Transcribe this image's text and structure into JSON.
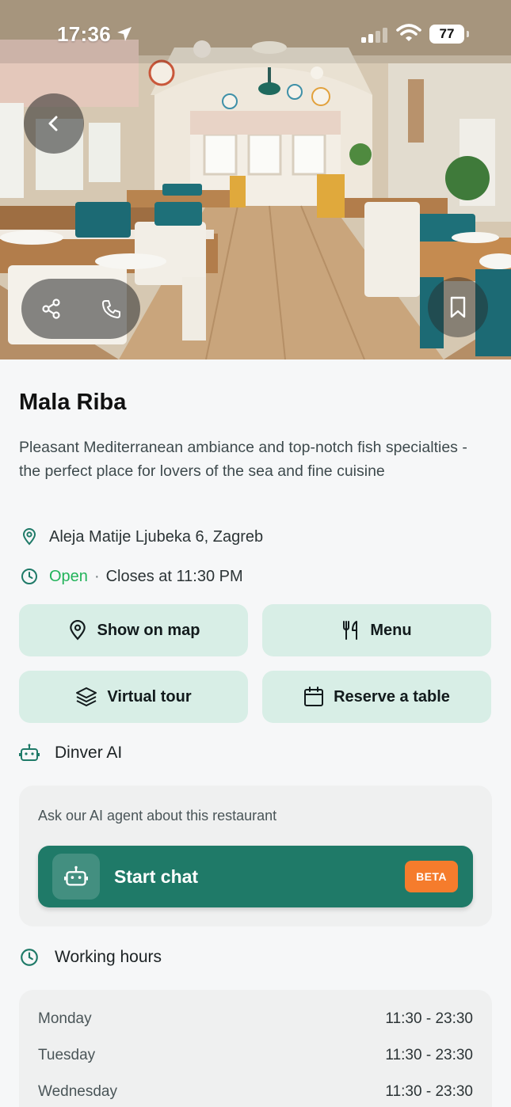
{
  "status_bar": {
    "time": "17:36",
    "battery": "77"
  },
  "hero": {
    "image": "restaurant interior photo with wooden tables and white chairs"
  },
  "restaurant": {
    "name": "Mala Riba",
    "description": "Pleasant Mediterranean ambiance and top-notch fish specialties - the perfect place for lovers of the sea and fine cuisine",
    "address": "Aleja Matije Ljubeka 6, Zagreb",
    "status": "Open",
    "separator": "·",
    "closes": "Closes at 11:30 PM"
  },
  "actions": {
    "show_on_map": "Show on map",
    "menu": "Menu",
    "virtual_tour": "Virtual tour",
    "reserve_table": "Reserve a table"
  },
  "ai": {
    "heading": "Dinver AI",
    "prompt": "Ask our AI agent about this restaurant",
    "button_label": "Start chat",
    "badge": "BETA"
  },
  "working_hours": {
    "heading": "Working hours",
    "days": [
      {
        "day": "Monday",
        "hours": "11:30 - 23:30"
      },
      {
        "day": "Tuesday",
        "hours": "11:30 - 23:30"
      },
      {
        "day": "Wednesday",
        "hours": "11:30 - 23:30"
      }
    ]
  },
  "colors": {
    "accent": "#1f7a68",
    "open_green": "#22b35a",
    "action_bg": "#d8eee6",
    "beta_orange": "#f57c2c"
  }
}
